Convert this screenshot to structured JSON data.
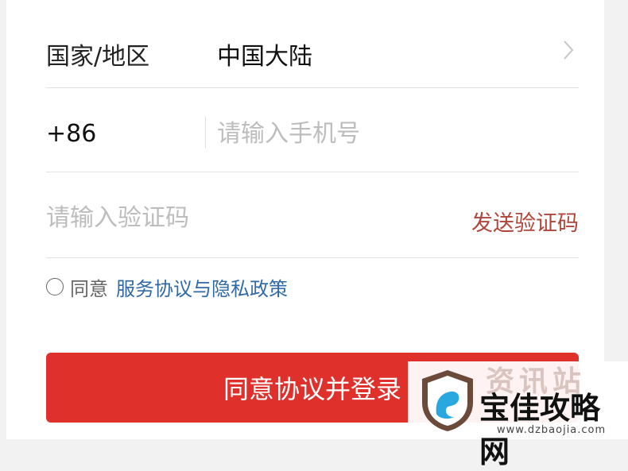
{
  "form": {
    "region_label": "国家/地区",
    "region_value": "中国大陆",
    "country_code": "+86",
    "phone_placeholder": "请输入手机号",
    "code_placeholder": "请输入验证码",
    "send_code": "发送验证码",
    "agree_prefix": "同意",
    "agree_link": "服务协议与隐私政策",
    "submit": "同意协议并登录"
  },
  "watermark": {
    "ghost_text": "资讯站",
    "site_name": "宝佳攻略网",
    "site_url": "www.dzbaojia.com"
  },
  "colors": {
    "primary_button": "#e0302c",
    "send_code_text": "#b0453a",
    "link_text": "#2f6aa6",
    "placeholder_text": "#bdbdbd"
  }
}
